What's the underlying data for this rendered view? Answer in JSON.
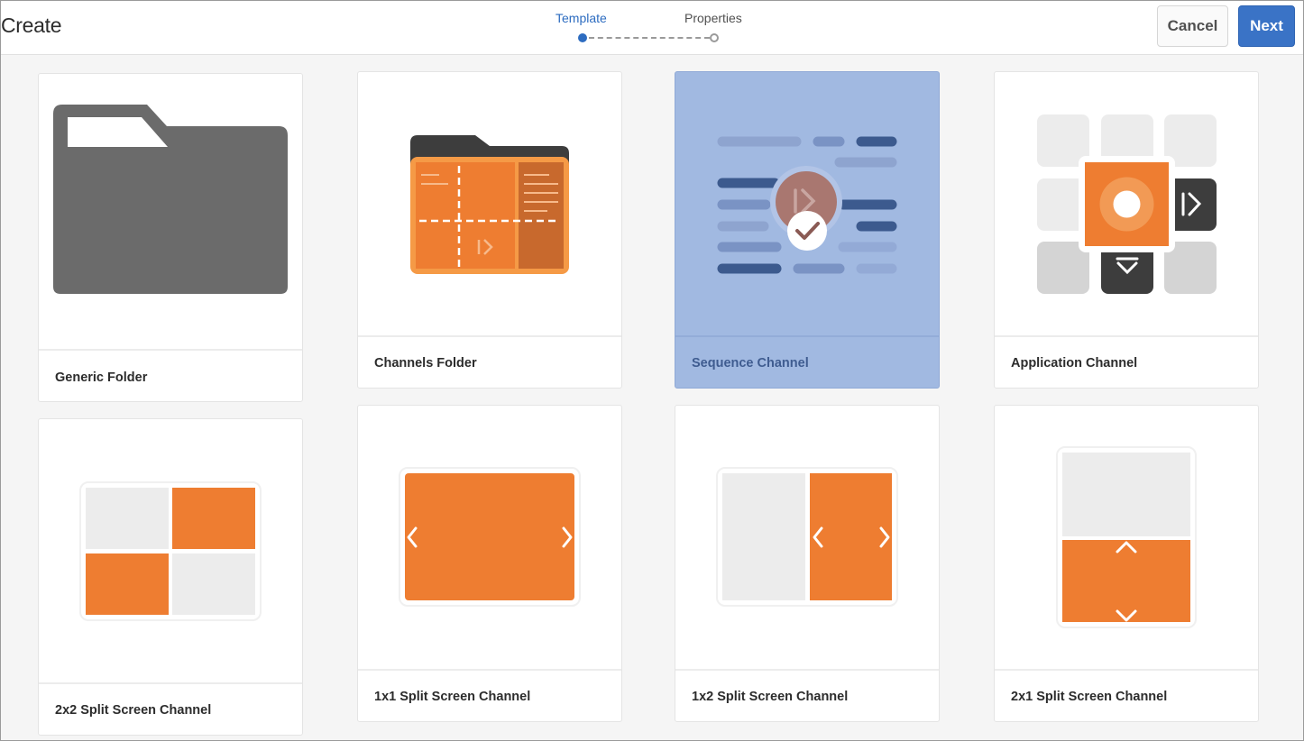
{
  "header": {
    "title": "Create",
    "steps": [
      "Template",
      "Properties"
    ],
    "active_step": 0,
    "cancel_label": "Cancel",
    "next_label": "Next"
  },
  "templates": [
    {
      "label": "Generic Folder",
      "icon": "generic-folder-icon",
      "selected": false
    },
    {
      "label": "Channels Folder",
      "icon": "channels-folder-icon",
      "selected": false
    },
    {
      "label": "Sequence Channel",
      "icon": "sequence-channel-icon",
      "selected": true
    },
    {
      "label": "Application Channel",
      "icon": "application-channel-icon",
      "selected": false
    },
    {
      "label": "2x2 Split Screen Channel",
      "icon": "split-2x2-icon",
      "selected": false
    },
    {
      "label": "1x1 Split Screen Channel",
      "icon": "split-1x1-icon",
      "selected": false
    },
    {
      "label": "1x2 Split Screen Channel",
      "icon": "split-1x2-icon",
      "selected": false
    },
    {
      "label": "2x1 Split Screen Channel",
      "icon": "split-2x1-icon",
      "selected": false
    }
  ],
  "colors": {
    "accent": "#2d6cc0",
    "next_button": "#3a73c6",
    "selected_card": "#a1b9e1",
    "orange": "#ee7d31",
    "folder_gray": "#6b6b6b"
  }
}
